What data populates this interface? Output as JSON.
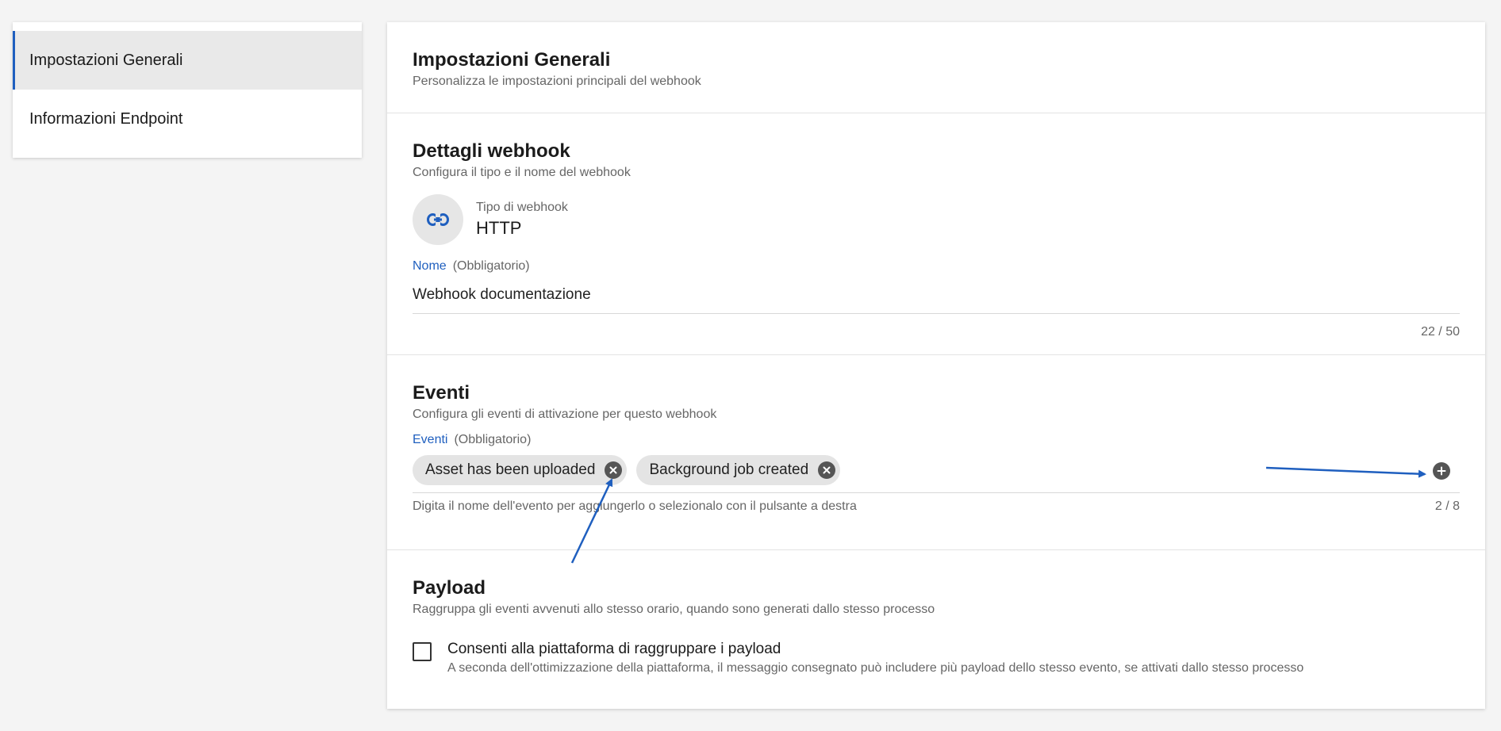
{
  "sidebar": {
    "items": [
      {
        "label": "Impostazioni Generali",
        "active": true
      },
      {
        "label": "Informazioni Endpoint",
        "active": false
      }
    ]
  },
  "header": {
    "title": "Impostazioni Generali",
    "subtitle": "Personalizza le impostazioni principali del webhook"
  },
  "details": {
    "title": "Dettagli webhook",
    "subtitle": "Configura il tipo e il nome del webhook",
    "type_label": "Tipo di webhook",
    "type_value": "HTTP",
    "type_icon": "link-icon",
    "name_label": "Nome",
    "name_required": "(Obbligatorio)",
    "name_value": "Webhook documentazione",
    "name_counter": "22 / 50"
  },
  "events": {
    "title": "Eventi",
    "subtitle": "Configura gli eventi di attivazione per questo webhook",
    "label": "Eventi",
    "required": "(Obbligatorio)",
    "chips": [
      "Asset has been uploaded",
      "Background job created"
    ],
    "hint": "Digita il nome dell'evento per aggiungerlo o selezionalo con il pulsante a destra",
    "counter": "2 / 8"
  },
  "payload": {
    "title": "Payload",
    "subtitle": "Raggruppa gli eventi avvenuti allo stesso orario, quando sono generati dallo stesso processo",
    "checkbox_label": "Consenti alla piattaforma di raggruppare i payload",
    "checkbox_desc": "A seconda dell'ottimizzazione della piattaforma, il messaggio consegnato può includere più payload dello stesso evento, se attivati dallo stesso processo",
    "checked": false
  },
  "colors": {
    "accent": "#1f5fbf",
    "annotation_arrow": "#1f5fbf"
  }
}
